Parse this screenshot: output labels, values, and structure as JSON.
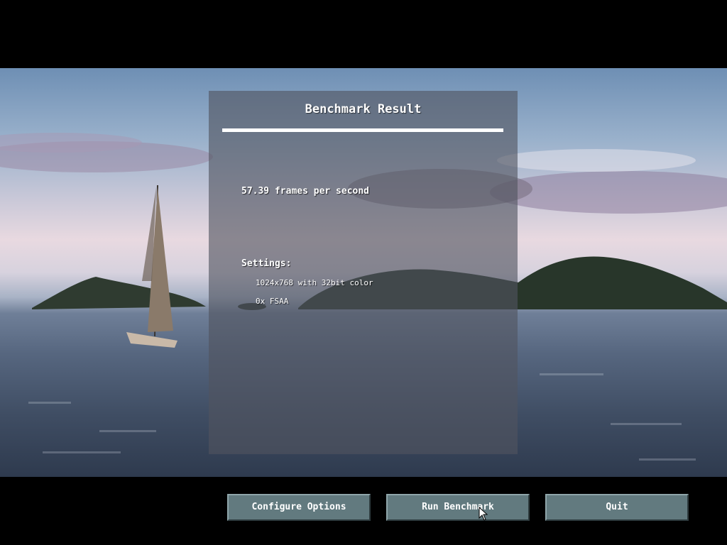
{
  "panel": {
    "title": "Benchmark Result",
    "fps_text": "57.39 frames per second",
    "settings_label": "Settings:",
    "settings": [
      "1024x768 with 32bit color",
      "0x FSAA"
    ]
  },
  "buttons": {
    "configure_label": "Configure Options",
    "run_label": "Run Benchmark",
    "quit_label": "Quit"
  },
  "colors": {
    "button_bg": "#627a7f",
    "panel_bg": "#505460",
    "text": "#ffffff",
    "letterbox": "#000000"
  }
}
